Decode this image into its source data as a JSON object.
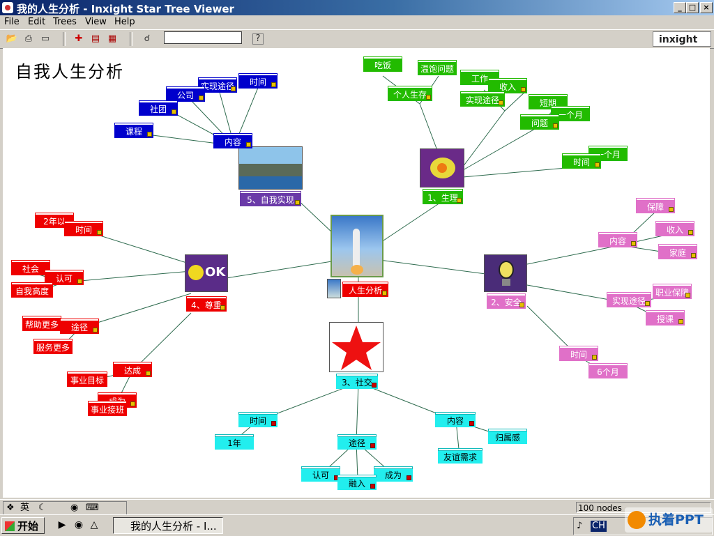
{
  "window": {
    "title": "我的人生分析 - Inxight Star Tree Viewer",
    "controls": [
      "_",
      "□",
      "×"
    ]
  },
  "menu": [
    "File",
    "Edit",
    "Trees",
    "View",
    "Help"
  ],
  "toolbar": {
    "search_value": "",
    "help": "?",
    "logo": "inxight"
  },
  "canvas_title": "自我人生分析",
  "center": "人生分析",
  "nodes": {
    "n1": "1、生理",
    "n2": "2、安全",
    "n3": "3、社交",
    "n4": "4、尊重",
    "n5": "5、自我实现",
    "g1": "个人生存",
    "g2": "吃饭",
    "g3": "温饱问题",
    "g4": "实现途径",
    "g5": "工作",
    "g6": "收入",
    "g7": "问题",
    "g8": "短期",
    "g9": "一个月",
    "g10": "时间",
    "g11": "一个月",
    "b1": "内容",
    "b2": "课程",
    "b3": "社团",
    "b4": "公司",
    "b5": "实现途径",
    "b6": "时间",
    "p1": "内容",
    "p2": "保障",
    "p3": "收入",
    "p4": "家庭",
    "p5": "实现途径",
    "p6": "职业保障",
    "p7": "授课",
    "p8": "时间",
    "p9": "6个月",
    "r1": "时间",
    "r2": "2年以",
    "r3": "认可",
    "r4": "社会",
    "r5": "自我高度",
    "r6": "途径",
    "r7": "帮助更多",
    "r8": "服务更多",
    "r9": "达成",
    "r10": "事业目标",
    "r11": "成为",
    "r12": "事业接班",
    "c1": "时间",
    "c2": "1年",
    "c3": "途径",
    "c4": "认可",
    "c5": "融入",
    "c6": "成为",
    "c7": "内容",
    "c8": "友谊需求",
    "c9": "归属感"
  },
  "status": {
    "ime": "英",
    "count": "100 nodes"
  },
  "taskbar": {
    "start": "开始",
    "app": "我的人生分析 - I...",
    "tray": "CH"
  },
  "watermark": "执着PPT",
  "colors": {
    "blue": "#0000cc",
    "green": "#22bb00",
    "red": "#ee0000",
    "pink": "#e070c8",
    "cyan": "#22eeee",
    "purple": "#6a3aa8",
    "edge": "#2e6b4e"
  }
}
